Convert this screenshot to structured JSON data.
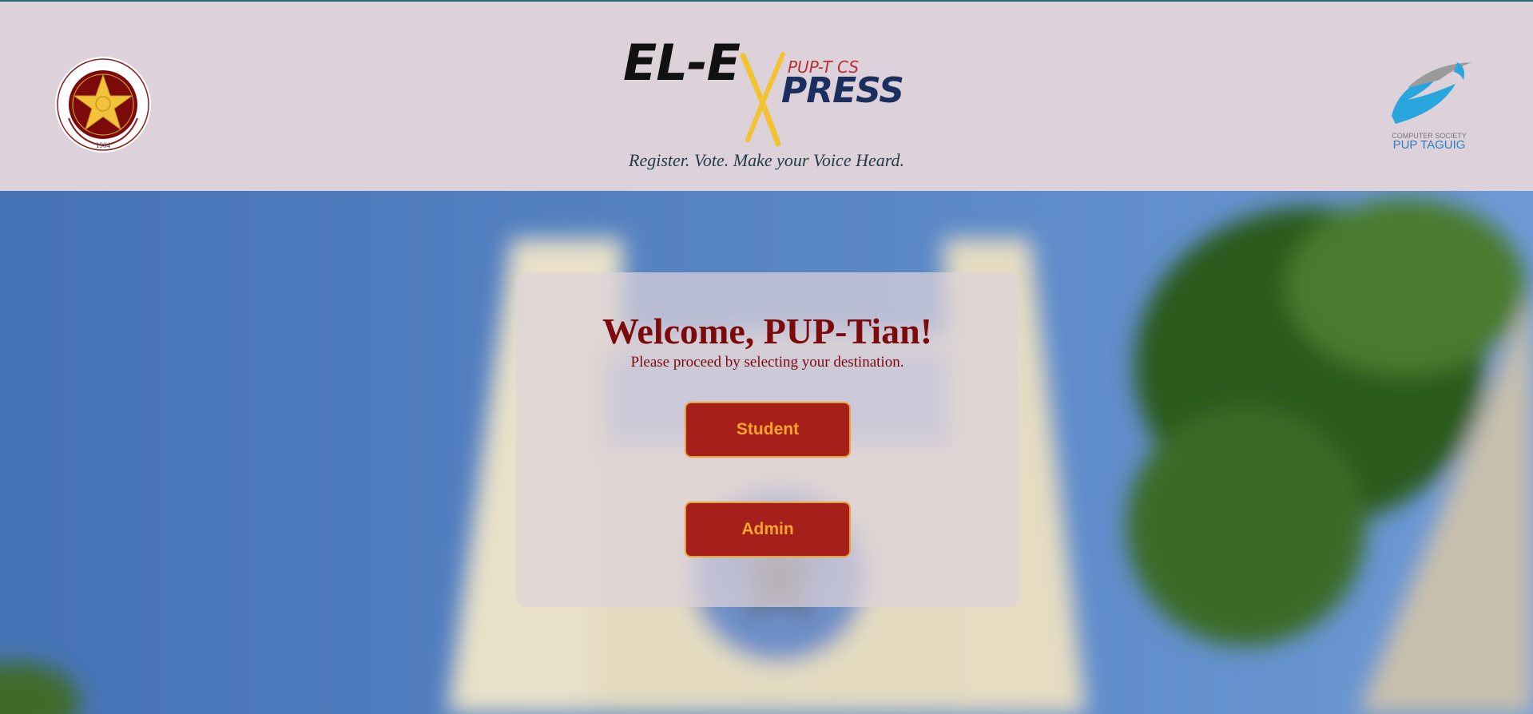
{
  "header": {
    "seal_text_ring": "POLYTECHNIC UNIVERSITY OF THE PHILIPPINES",
    "seal_year": "1904",
    "brand_main": "EL-E",
    "brand_sub": "PUP-T CS",
    "brand_press": "PRESS",
    "tagline": "Register. Vote. Make your Voice Heard.",
    "cs_logo_line1": "COMPUTER SOCIETY",
    "cs_logo_line2": "PUP TAGUIG"
  },
  "card": {
    "title": "Welcome, PUP-Tian!",
    "subtitle": "Please proceed by selecting your destination.",
    "student_label": "Student",
    "admin_label": "Admin"
  },
  "colors": {
    "header_bg": "#ddd2da",
    "accent_red": "#a71f1a",
    "button_text": "#f4a62a",
    "title_red": "#7d0a0a"
  },
  "icons": [
    "pup-seal-logo",
    "cs-pup-taguig-logo"
  ]
}
